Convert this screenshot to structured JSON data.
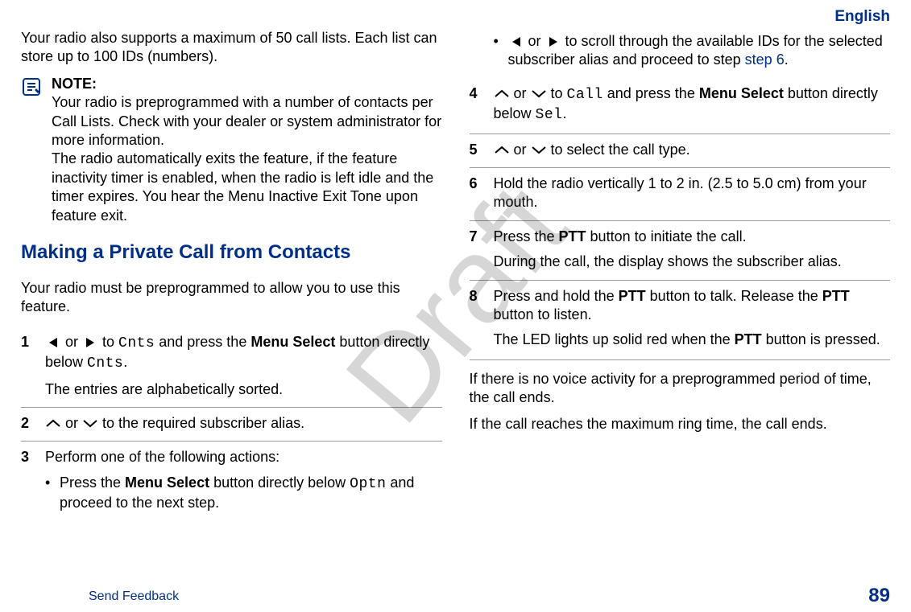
{
  "language_label": "English",
  "watermark": "Draft",
  "intro_para": "Your radio also supports a maximum of 50 call lists. Each list can store up to 100 IDs (numbers).",
  "note": {
    "label": "NOTE:",
    "p1": "Your radio is preprogrammed with a number of contacts per Call Lists. Check with your dealer or system administrator for more information.",
    "p2": "The radio automatically exits the feature, if the feature inactivity timer is enabled, when the radio is left idle and the timer expires. You hear the Menu Inactive Exit Tone upon feature exit."
  },
  "heading": "Making a Private Call from Contacts",
  "precondition": "Your radio must be preprogrammed to allow you to use this feature.",
  "steps": {
    "s1": {
      "num": "1",
      "t1a": " or ",
      "t1b": " to ",
      "cnts": "Cnts",
      "t1c": " and press the ",
      "menu_select": "Menu Select",
      "t1d": " button directly below ",
      "cnts2": "Cnts",
      "t1e": ".",
      "after": "The entries are alphabetically sorted."
    },
    "s2": {
      "num": "2",
      "t_or": " or ",
      "t_rest": " to the required subscriber alias."
    },
    "s3": {
      "num": "3",
      "lead": "Perform one of the following actions:",
      "a_pre": "Press the ",
      "a_ms": "Menu Select",
      "a_mid": " button directly below ",
      "a_optn": "Optn",
      "a_post": " and proceed to the next step.",
      "b_or": " or ",
      "b_text": " to scroll through the available IDs for the selected subscriber alias and proceed to step ",
      "b_link": "step 6",
      "b_period": "."
    },
    "s4": {
      "num": "4",
      "t_or": " or ",
      "t_to": " to ",
      "call": "Call",
      "t_and": " and press the ",
      "ms": "Menu Select",
      "t_below": " button directly below ",
      "sel": "Sel",
      "t_period": "."
    },
    "s5": {
      "num": "5",
      "t_or": " or ",
      "t_rest": " to select the call type."
    },
    "s6": {
      "num": "6",
      "text": "Hold the radio vertically 1 to 2 in. (2.5 to 5.0 cm) from your mouth."
    },
    "s7": {
      "num": "7",
      "p1a": "Press the ",
      "ptt": "PTT",
      "p1b": " button to initiate the call.",
      "p2": "During the call, the display shows the subscriber alias."
    },
    "s8": {
      "num": "8",
      "p1a": "Press and hold the ",
      "ptt1": "PTT",
      "p1b": " button to talk. Release the ",
      "ptt2": "PTT",
      "p1c": " button to listen.",
      "p2a": "The LED lights up solid red when the ",
      "ptt3": "PTT",
      "p2b": " button is pressed."
    }
  },
  "closing": {
    "p1": "If there is no voice activity for a preprogrammed period of time, the call ends.",
    "p2": "If the call reaches the maximum ring time, the call ends."
  },
  "footer": {
    "send_feedback": "Send Feedback",
    "page_number": "89"
  }
}
